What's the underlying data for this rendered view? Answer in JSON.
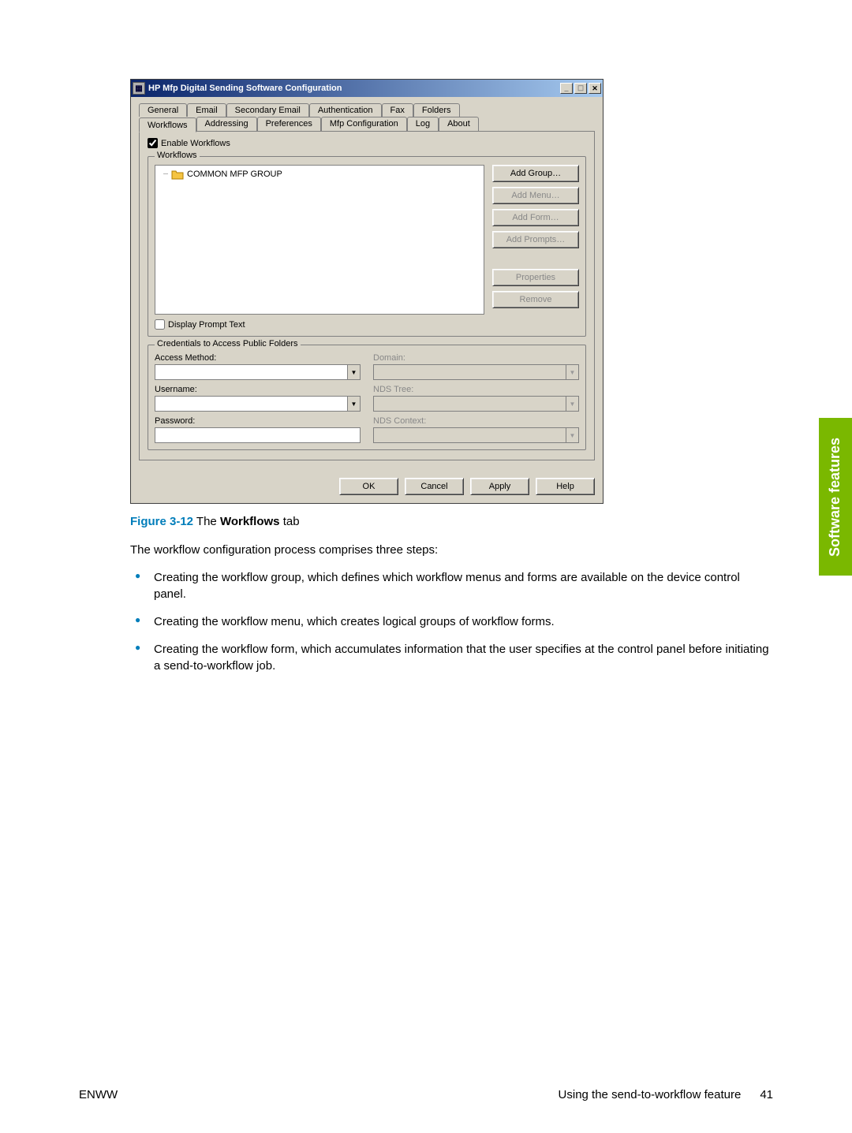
{
  "window": {
    "title": "HP Mfp Digital Sending Software Configuration",
    "tabs_row1": [
      "General",
      "Email",
      "Secondary Email",
      "Authentication",
      "Fax",
      "Folders"
    ],
    "tabs_row2": [
      "Workflows",
      "Addressing",
      "Preferences",
      "Mfp Configuration",
      "Log",
      "About"
    ],
    "active_tab": "Workflows",
    "enable_workflows_label": "Enable Workflows",
    "workflows_group": {
      "legend": "Workflows",
      "tree_item": "COMMON MFP GROUP",
      "buttons": {
        "add_group": "Add Group…",
        "add_menu": "Add Menu…",
        "add_form": "Add Form…",
        "add_prompts": "Add Prompts…",
        "properties": "Properties",
        "remove": "Remove"
      },
      "display_prompt_text_label": "Display Prompt Text"
    },
    "credentials_group": {
      "legend": "Credentials to Access Public Folders",
      "labels": {
        "access_method": "Access Method:",
        "domain": "Domain:",
        "username": "Username:",
        "nds_tree": "NDS Tree:",
        "password": "Password:",
        "nds_context": "NDS Context:"
      }
    },
    "dlg_buttons": {
      "ok": "OK",
      "cancel": "Cancel",
      "apply": "Apply",
      "help": "Help"
    }
  },
  "caption": {
    "fig_label": "Figure 3-12",
    "fig_prefix": " The ",
    "fig_bold": "Workflows",
    "fig_suffix": " tab"
  },
  "body_paragraph": "The workflow configuration process comprises three steps:",
  "bullets": [
    "Creating the workflow group, which defines which workflow menus and forms are available on the device control panel.",
    "Creating the workflow menu, which creates logical groups of workflow forms.",
    "Creating the workflow form, which accumulates information that the user specifies at the control panel before initiating a send-to-workflow job."
  ],
  "side_tab": "Software features",
  "footer": {
    "left": "ENWW",
    "right_text": "Using the send-to-workflow feature",
    "page": "41"
  }
}
